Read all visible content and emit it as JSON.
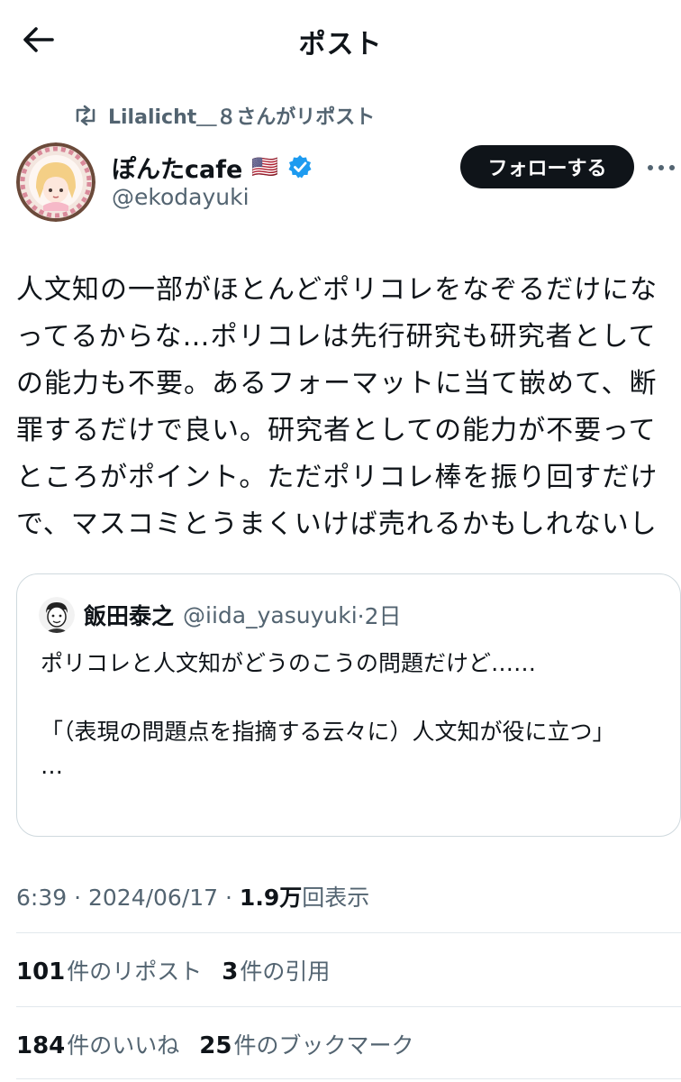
{
  "header": {
    "title": "ポスト"
  },
  "repost": {
    "text": "Lilalicht＿８さんがリポスト"
  },
  "author": {
    "name": "ぽんたcafe",
    "flag": "🇺🇸",
    "handle": "@ekodayuki",
    "follow_label": "フォローする"
  },
  "tweet": {
    "text": "人文知の一部がほとんどポリコレをなぞるだけになってるからな…ポリコレは先行研究も研究者としての能力も不要。あるフォーマットに当て嵌めて、断罪するだけで良い。研究者としての能力が不要ってところがポイント。ただポリコレ棒を振り回すだけで、マスコミとうまくいけば売れるかもしれないし"
  },
  "quote": {
    "name": "飯田泰之",
    "handle": "@iida_yasuyuki",
    "time": "·2日",
    "text": "ポリコレと人文知がどうのこうの問題だけど……\n\n「（表現の問題点を指摘する云々に）人文知が役に立つ」\n…"
  },
  "meta": {
    "time": "6:39",
    "sep1": " · ",
    "date": "2024/06/17",
    "sep2": " · ",
    "views": "1.9万",
    "views_label": "回表示"
  },
  "stats": {
    "reposts": "101",
    "reposts_label": "件のリポスト",
    "quotes": "3",
    "quotes_label": "件の引用",
    "likes": "184",
    "likes_label": "件のいいね",
    "bookmarks": "25",
    "bookmarks_label": "件のブックマーク"
  },
  "icons": {
    "back": "back-arrow-icon",
    "repost": "repost-icon",
    "verified": "verified-badge-icon",
    "more": "more-icon"
  },
  "colors": {
    "text": "#0f1419",
    "secondary": "#536471",
    "verified": "#1d9bf0",
    "border": "#cfd9de",
    "follow_bg": "#0f1419"
  }
}
